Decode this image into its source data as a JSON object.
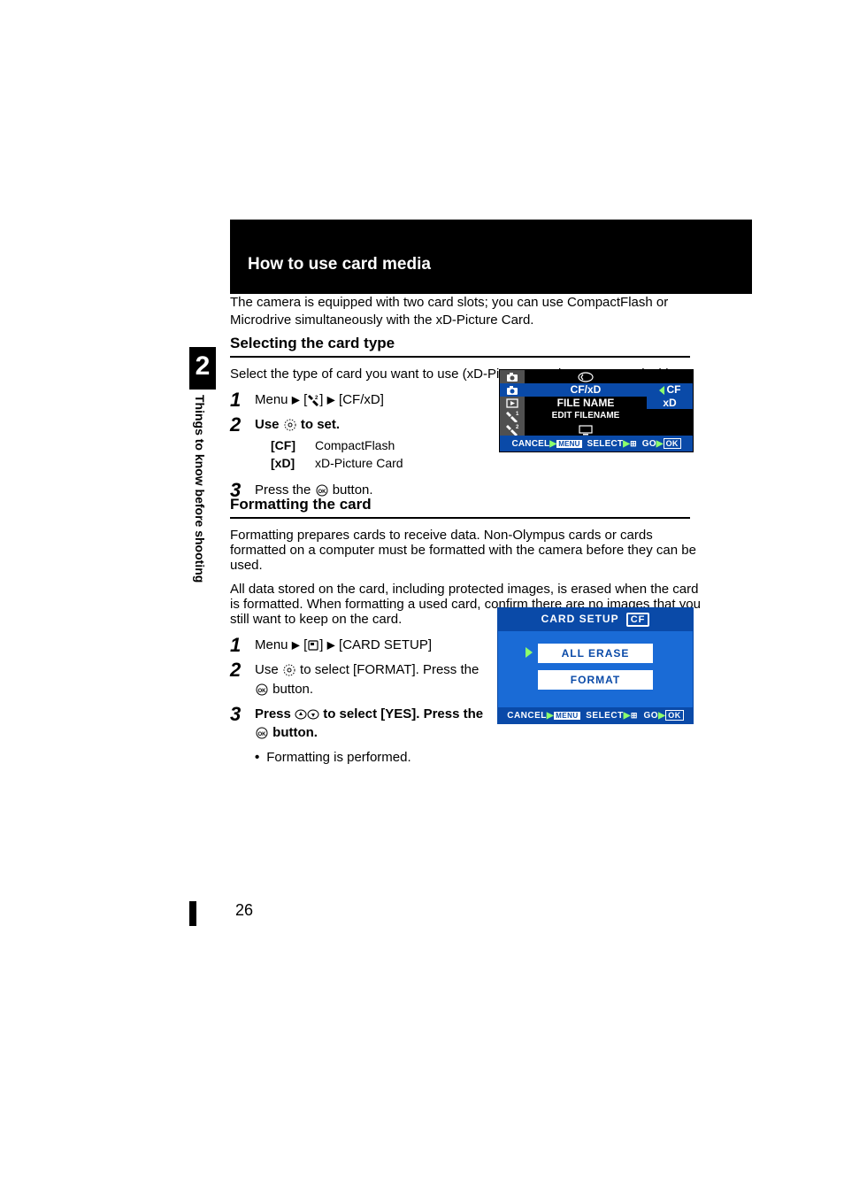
{
  "chapter_number": "2",
  "side_label": "Things to know before shooting",
  "page_number": "26",
  "section_title": "How to use card media",
  "intro": "The camera is equipped with two card slots; you can use CompactFlash or Microdrive simultaneously with the xD-Picture Card.",
  "selecting": {
    "heading": "Selecting the card type",
    "intro": "Select the type of card you want to use  (xD-Picture Card or CompactFlash).",
    "step1_pre": "Menu",
    "step1_arrow": "▶",
    "step1_mid": "[",
    "step1_mid2": "]",
    "step1_post": "[CF/xD]",
    "step2_pre": "Use",
    "step2_post": " to set.",
    "defs": [
      {
        "k": "[CF]",
        "v": "CompactFlash"
      },
      {
        "k": "[xD]",
        "v": "xD-Picture Card"
      }
    ],
    "step3_pre": "Press the ",
    "step3_post": " button."
  },
  "formatting": {
    "heading": "Formatting the card",
    "para1": "Formatting prepares cards to receive data. Non-Olympus cards or cards formatted on a computer must be formatted with the camera before they can be used.",
    "para2": "All data stored on the card, including protected images, is erased when the card is formatted. When formatting a used card, confirm there are no images that you still want to keep on the card.",
    "step1_pre": "Menu",
    "step1_arrow": "▶",
    "step1_mid": "[",
    "step1_mid2": "]",
    "step1_post": "[CARD SETUP]",
    "step2_pre": "Use",
    "step2_mid": " to select [FORMAT]. Press the ",
    "step2_post": "button.",
    "step3_pre": "Press ",
    "step3_mid": " to select [YES]. Press the ",
    "step3_post": " button.",
    "bullet": "Formatting is performed."
  },
  "menu1": {
    "rows": [
      {
        "mid": "",
        "right": ""
      },
      {
        "mid": "CF/xD",
        "right": "CF",
        "sel": true
      },
      {
        "mid": "FILE NAME",
        "right": "xD"
      },
      {
        "mid": "EDIT FILENAME",
        "right": ""
      },
      {
        "mid": "",
        "right": ""
      }
    ],
    "footer_cancel": "CANCEL",
    "footer_select": "SELECT",
    "footer_go": "GO",
    "footer_menu": "MENU",
    "footer_ok": "OK"
  },
  "menu2": {
    "title": "CARD SETUP",
    "tag": "CF",
    "btn1": "ALL ERASE",
    "btn2": "FORMAT",
    "footer_cancel": "CANCEL",
    "footer_menu": "MENU",
    "footer_select": "SELECT",
    "footer_go": "GO",
    "footer_ok": "OK"
  }
}
